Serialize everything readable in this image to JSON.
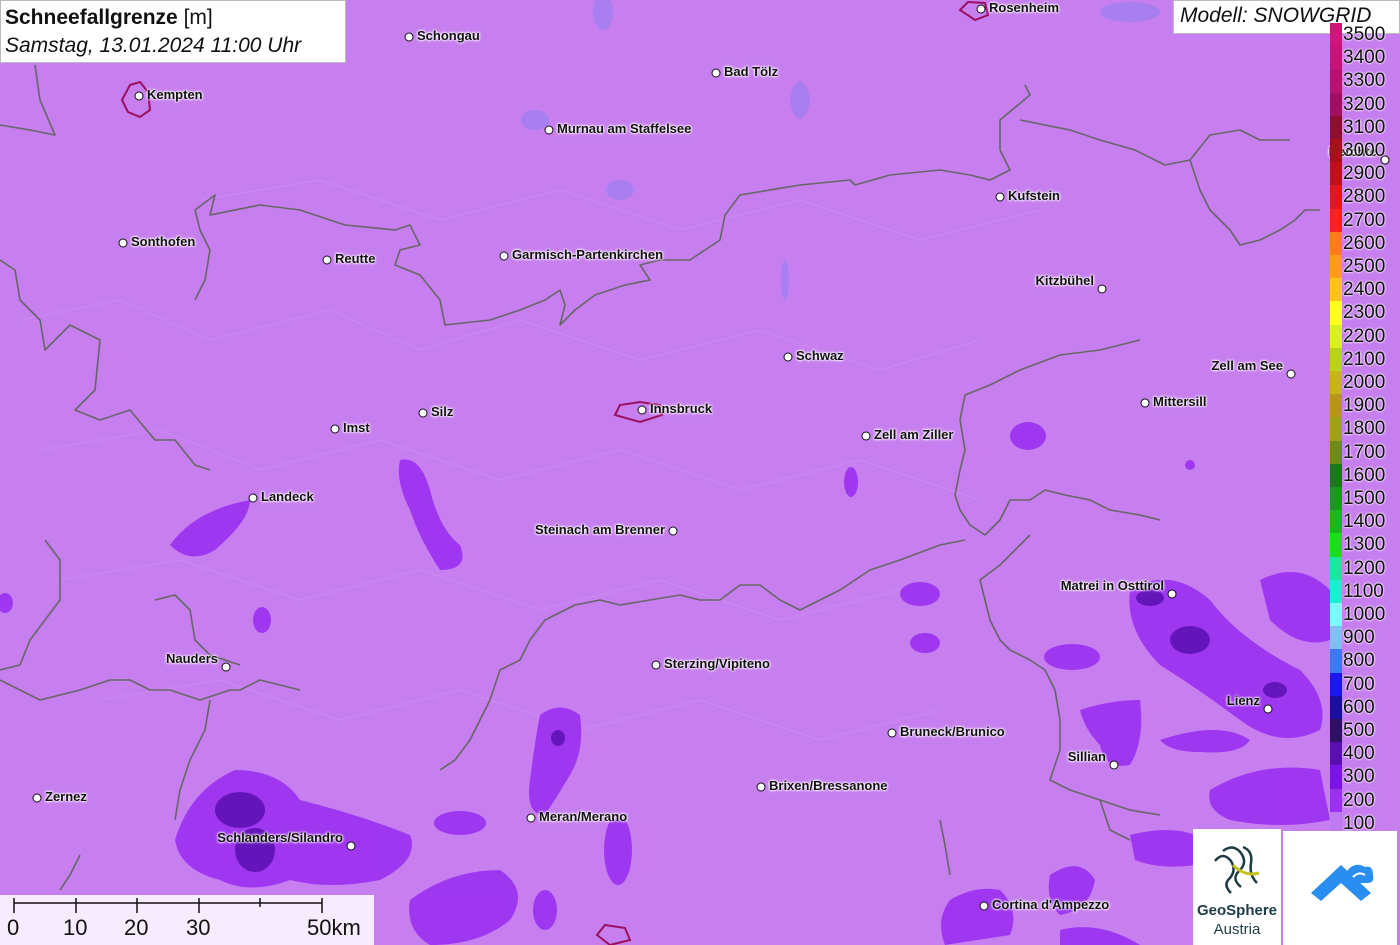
{
  "title": {
    "main": "Schneefallgrenze",
    "unit": "[m]",
    "datetime": "Samstag, 13.01.2024 11:00 Uhr"
  },
  "model": "Modell: SNOWGRID",
  "cities": [
    {
      "name": "Rosenheim",
      "label": "Rosenheim"
    },
    {
      "name": "Schongau",
      "label": "Schongau"
    },
    {
      "name": "Bad Tölz",
      "label": "Bad Tölz"
    },
    {
      "name": "Kempten",
      "label": "Kempten"
    },
    {
      "name": "Murnau",
      "label": "Murnau am Staffelsee"
    },
    {
      "name": "Berchtesgaden",
      "label": "Berchte"
    },
    {
      "name": "Kufstein",
      "label": "Kufstein"
    },
    {
      "name": "Sonthofen",
      "label": "Sonthofen"
    },
    {
      "name": "Reutte",
      "label": "Reutte"
    },
    {
      "name": "Garmisch",
      "label": "Garmisch-Partenkirchen"
    },
    {
      "name": "Kitzbühel",
      "label": "Kitzbühel"
    },
    {
      "name": "Schwaz",
      "label": "Schwaz"
    },
    {
      "name": "Zell am See",
      "label": "Zell am See"
    },
    {
      "name": "Mittersill",
      "label": "Mittersill"
    },
    {
      "name": "Innsbruck",
      "label": "Innsbruck"
    },
    {
      "name": "Imst",
      "label": "Imst"
    },
    {
      "name": "Silz",
      "label": "Silz"
    },
    {
      "name": "Zell am Ziller",
      "label": "Zell am Ziller"
    },
    {
      "name": "Landeck",
      "label": "Landeck"
    },
    {
      "name": "Steinach",
      "label": "Steinach am Brenner"
    },
    {
      "name": "Matrei",
      "label": "Matrei in Osttirol"
    },
    {
      "name": "Nauders",
      "label": "Nauders"
    },
    {
      "name": "Sterzing",
      "label": "Sterzing/Vipiteno"
    },
    {
      "name": "Lienz",
      "label": "Lienz"
    },
    {
      "name": "Bruneck",
      "label": "Bruneck/Brunico"
    },
    {
      "name": "Sillian",
      "label": "Sillian"
    },
    {
      "name": "Brixen",
      "label": "Brixen/Bressanone"
    },
    {
      "name": "Zernez",
      "label": "Zernez"
    },
    {
      "name": "Meran",
      "label": "Meran/Merano"
    },
    {
      "name": "Schlanders",
      "label": "Schlanders/Silandro"
    },
    {
      "name": "Cortina",
      "label": "Cortina d'Ampezzo"
    }
  ],
  "legend": {
    "levels": [
      {
        "label": "3500",
        "color": "#d1157a"
      },
      {
        "label": "3400",
        "color": "#c81478"
      },
      {
        "label": "3300",
        "color": "#b8126e"
      },
      {
        "label": "3200",
        "color": "#a0105e"
      },
      {
        "label": "3100",
        "color": "#8e0e2e"
      },
      {
        "label": "3000",
        "color": "#a8101a"
      },
      {
        "label": "2900",
        "color": "#c0101a"
      },
      {
        "label": "2800",
        "color": "#e01818"
      },
      {
        "label": "2700",
        "color": "#ff2020"
      },
      {
        "label": "2600",
        "color": "#ff7a1a"
      },
      {
        "label": "2500",
        "color": "#ff9a1a"
      },
      {
        "label": "2400",
        "color": "#ffc21a"
      },
      {
        "label": "2300",
        "color": "#ffff20"
      },
      {
        "label": "2200",
        "color": "#d8f020"
      },
      {
        "label": "2100",
        "color": "#b8d418"
      },
      {
        "label": "2000",
        "color": "#c8b41a"
      },
      {
        "label": "1900",
        "color": "#b8941a"
      },
      {
        "label": "1800",
        "color": "#a0a01a"
      },
      {
        "label": "1700",
        "color": "#6e8a1a"
      },
      {
        "label": "1600",
        "color": "#1a7a1a"
      },
      {
        "label": "1500",
        "color": "#1a9a1a"
      },
      {
        "label": "1400",
        "color": "#1ab81a"
      },
      {
        "label": "1300",
        "color": "#1ade1a"
      },
      {
        "label": "1200",
        "color": "#1ae8a0"
      },
      {
        "label": "1100",
        "color": "#1af0d0"
      },
      {
        "label": "1000",
        "color": "#80f8f8"
      },
      {
        "label": "900",
        "color": "#80c0f0"
      },
      {
        "label": "800",
        "color": "#3a7af0"
      },
      {
        "label": "700",
        "color": "#1a1af0"
      },
      {
        "label": "600",
        "color": "#1a10a0"
      },
      {
        "label": "500",
        "color": "#301060"
      },
      {
        "label": "400",
        "color": "#5a10b0"
      },
      {
        "label": "300",
        "color": "#7a14e8"
      },
      {
        "label": "200",
        "color": "#9a30f0"
      },
      {
        "label": "100",
        "color": "#c07af0"
      }
    ]
  },
  "scalebar": {
    "ticks": [
      "0",
      "10",
      "20",
      "30",
      "50km"
    ]
  },
  "logos": {
    "geosphere_line1": "GeoSphere",
    "geosphere_line2": "Austria"
  },
  "colors": {
    "base_fill": "#c77ff0",
    "low_fill": "#9a30f0",
    "lowest_fill": "#5a10b0",
    "border": "#666666"
  }
}
